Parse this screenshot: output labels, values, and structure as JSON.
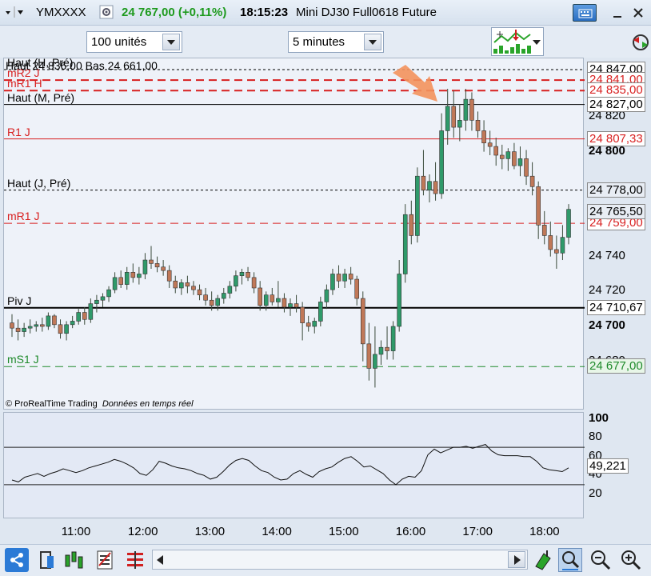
{
  "header": {
    "symbol": "YMXXXX",
    "price": "24 767,00 (+0,11%)",
    "time": "18:15:23",
    "description": "Mini DJ30 Full0618 Future",
    "settings_icon": "gear-icon",
    "keyboard_icon": "keyboard-icon"
  },
  "toolbar": {
    "units_value": "100 unités",
    "interval_value": "5 minutes",
    "indicator_icon": "chart-indicators-icon"
  },
  "info": {
    "ohlc": "Haut 24 836,00 Bas 24 661,00",
    "copyright": "© ProRealTime Trading",
    "data_note": "Données en temps réel"
  },
  "levels": [
    {
      "label": "Haut (H, Pré)",
      "value": "24 847,00",
      "color": "#000000",
      "style": "dotted"
    },
    {
      "label": "mR2 J",
      "value": "24 841,00",
      "color": "#d82020",
      "style": "dashed"
    },
    {
      "label": "mR1 H",
      "value": "24 835,00",
      "color": "#d82020",
      "style": "dashed"
    },
    {
      "label": "Haut (M, Pré)",
      "value": "24 827,00",
      "color": "#000000",
      "style": "solid"
    },
    {
      "label": "R1 J",
      "value": "24 807,33",
      "color": "#d82020",
      "style": "solid"
    },
    {
      "label": "Haut (J, Pré)",
      "value": "24 778,00",
      "color": "#000000",
      "style": "dotted"
    },
    {
      "label": "mR1 J",
      "value": "24 759,00",
      "color": "#d82020",
      "style": "dashed"
    },
    {
      "label": "Piv J",
      "value": "24 710,67",
      "color": "#000000",
      "style": "solid"
    },
    {
      "label": "mS1 J",
      "value": "24 677,00",
      "color": "#1e8a2a",
      "style": "dashed"
    }
  ],
  "price_axis": {
    "ticks": [
      "24 820",
      "24 800",
      "24 740",
      "24 720",
      "24 700",
      "24 680"
    ],
    "bold_ticks": [
      "24 800",
      "24 700"
    ],
    "extra_labels": [
      "24 778,00",
      "24 765,50"
    ]
  },
  "indicator_axis": {
    "ticks": [
      "100",
      "80",
      "60",
      "40",
      "20"
    ],
    "current": "49,221",
    "upper_band": 70,
    "lower_band": 30
  },
  "time_axis": [
    "11:00",
    "12:00",
    "13:00",
    "14:00",
    "15:00",
    "16:00",
    "17:00",
    "18:00"
  ],
  "chart_data": {
    "type": "candlestick",
    "interval": "5 minutes",
    "candles": [
      [
        24702,
        24707,
        24694,
        24699
      ],
      [
        24699,
        24704,
        24692,
        24697
      ],
      [
        24697,
        24702,
        24694,
        24699
      ],
      [
        24699,
        24704,
        24696,
        24700
      ],
      [
        24700,
        24703,
        24697,
        24701
      ],
      [
        24701,
        24705,
        24697,
        24700
      ],
      [
        24700,
        24708,
        24698,
        24706
      ],
      [
        24706,
        24707,
        24699,
        24701
      ],
      [
        24701,
        24704,
        24693,
        24696
      ],
      [
        24696,
        24703,
        24692,
        24701
      ],
      [
        24701,
        24706,
        24699,
        24703
      ],
      [
        24703,
        24710,
        24701,
        24708
      ],
      [
        24708,
        24711,
        24701,
        24704
      ],
      [
        24704,
        24716,
        24702,
        24713
      ],
      [
        24713,
        24718,
        24708,
        24715
      ],
      [
        24715,
        24719,
        24711,
        24717
      ],
      [
        24717,
        24723,
        24714,
        24721
      ],
      [
        24721,
        24731,
        24719,
        24728
      ],
      [
        24728,
        24732,
        24722,
        24724
      ],
      [
        24724,
        24734,
        24721,
        24731
      ],
      [
        24731,
        24736,
        24725,
        24728
      ],
      [
        24728,
        24734,
        24724,
        24730
      ],
      [
        24730,
        24742,
        24727,
        24738
      ],
      [
        24738,
        24746,
        24733,
        24736
      ],
      [
        24736,
        24740,
        24731,
        24734
      ],
      [
        24734,
        24738,
        24729,
        24732
      ],
      [
        24732,
        24735,
        24722,
        24726
      ],
      [
        24726,
        24729,
        24719,
        24722
      ],
      [
        24722,
        24727,
        24718,
        24725
      ],
      [
        24725,
        24729,
        24719,
        24723
      ],
      [
        24723,
        24726,
        24718,
        24721
      ],
      [
        24721,
        24724,
        24715,
        24718
      ],
      [
        24718,
        24722,
        24712,
        24715
      ],
      [
        24715,
        24720,
        24709,
        24712
      ],
      [
        24712,
        24718,
        24709,
        24716
      ],
      [
        24716,
        24722,
        24713,
        24719
      ],
      [
        24719,
        24726,
        24716,
        24723
      ],
      [
        24723,
        24732,
        24720,
        24729
      ],
      [
        24729,
        24733,
        24724,
        24731
      ],
      [
        24731,
        24734,
        24726,
        24728
      ],
      [
        24728,
        24731,
        24719,
        24722
      ],
      [
        24722,
        24726,
        24709,
        24712
      ],
      [
        24712,
        24720,
        24709,
        24718
      ],
      [
        24718,
        24722,
        24712,
        24714
      ],
      [
        24714,
        24726,
        24711,
        24716
      ],
      [
        24716,
        24719,
        24708,
        24711
      ],
      [
        24711,
        24716,
        24706,
        24713
      ],
      [
        24713,
        24718,
        24708,
        24711
      ],
      [
        24711,
        24714,
        24692,
        24702
      ],
      [
        24702,
        24706,
        24697,
        24700
      ],
      [
        24700,
        24705,
        24696,
        24703
      ],
      [
        24703,
        24717,
        24700,
        24714
      ],
      [
        24714,
        24724,
        24710,
        24721
      ],
      [
        24721,
        24733,
        24718,
        24730
      ],
      [
        24730,
        24735,
        24722,
        24726
      ],
      [
        24726,
        24733,
        24722,
        24730
      ],
      [
        24730,
        24734,
        24724,
        24727
      ],
      [
        24727,
        24729,
        24712,
        24716
      ],
      [
        24716,
        24720,
        24680,
        24690
      ],
      [
        24690,
        24702,
        24669,
        24676
      ],
      [
        24676,
        24700,
        24665,
        24684
      ],
      [
        24684,
        24692,
        24678,
        24688
      ],
      [
        24688,
        24700,
        24681,
        24686
      ],
      [
        24686,
        24703,
        24681,
        24700
      ],
      [
        24700,
        24738,
        24697,
        24730
      ],
      [
        24730,
        24770,
        24725,
        24764
      ],
      [
        24764,
        24772,
        24747,
        24752
      ],
      [
        24752,
        24791,
        24748,
        24786
      ],
      [
        24786,
        24801,
        24775,
        24778
      ],
      [
        24778,
        24787,
        24771,
        24783
      ],
      [
        24783,
        24794,
        24772,
        24776
      ],
      [
        24776,
        24822,
        24773,
        24812
      ],
      [
        24812,
        24836,
        24804,
        24826
      ],
      [
        24826,
        24835,
        24808,
        24814
      ],
      [
        24814,
        24827,
        24806,
        24818
      ],
      [
        24818,
        24836,
        24812,
        24830
      ],
      [
        24830,
        24834,
        24812,
        24818
      ],
      [
        24818,
        24823,
        24808,
        24812
      ],
      [
        24812,
        24818,
        24800,
        24805
      ],
      [
        24805,
        24812,
        24798,
        24803
      ],
      [
        24803,
        24808,
        24792,
        24798
      ],
      [
        24798,
        24804,
        24790,
        24796
      ],
      [
        24796,
        24802,
        24789,
        24800
      ],
      [
        24800,
        24805,
        24790,
        24792
      ],
      [
        24792,
        24803,
        24786,
        24796
      ],
      [
        24796,
        24801,
        24781,
        24786
      ],
      [
        24786,
        24794,
        24775,
        24780
      ],
      [
        24780,
        24783,
        24750,
        24758
      ],
      [
        24758,
        24766,
        24747,
        24752
      ],
      [
        24752,
        24760,
        24740,
        24744
      ],
      [
        24744,
        24752,
        24733,
        24742
      ],
      [
        24742,
        24758,
        24738,
        24751
      ],
      [
        24751,
        24770,
        24747,
        24767
      ]
    ],
    "oscillator": [
      35,
      33,
      38,
      40,
      42,
      39,
      42,
      44,
      47,
      45,
      43,
      45,
      48,
      50,
      52,
      54,
      57,
      55,
      52,
      48,
      42,
      40,
      46,
      55,
      53,
      50,
      48,
      47,
      45,
      42,
      40,
      36,
      38,
      44,
      51,
      56,
      58,
      56,
      50,
      45,
      43,
      38,
      35,
      36,
      42,
      45,
      41,
      38,
      44,
      47,
      49,
      54,
      58,
      60,
      55,
      49,
      50,
      46,
      42,
      35,
      30,
      36,
      39,
      38,
      45,
      62,
      68,
      64,
      67,
      70,
      70,
      71,
      69,
      71,
      73,
      66,
      62,
      61,
      61,
      61,
      60,
      60,
      55,
      48,
      46,
      45,
      44,
      48
    ],
    "oscillator_range": [
      0,
      100
    ]
  }
}
